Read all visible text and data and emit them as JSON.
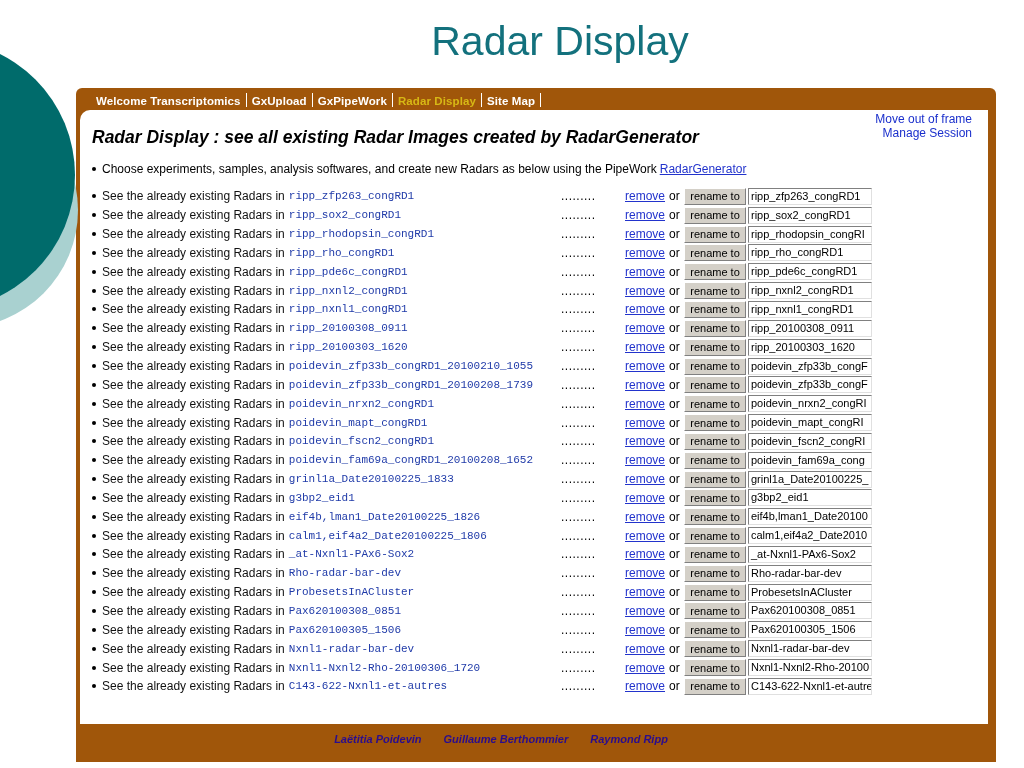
{
  "slide_title": "Radar Display",
  "nav": [
    {
      "label": "Welcome Transcriptomics",
      "selected": false
    },
    {
      "label": "GxUpload",
      "selected": false
    },
    {
      "label": "GxPipeWork",
      "selected": false
    },
    {
      "label": "Radar Display",
      "selected": true
    },
    {
      "label": "Site Map",
      "selected": false
    }
  ],
  "frame_links": [
    "Move out of frame",
    "Manage Session"
  ],
  "heading": "Radar Display : see all existing Radar Images created by RadarGenerator",
  "intro": {
    "text": "Choose experiments, samples, analysis softwares, and create new Radars as below using the PipeWork",
    "link": "RadarGenerator"
  },
  "rows": [
    {
      "prefix": "See the already existing Radars in",
      "name": "ripp_zfp263_congRD1",
      "dots": ".........",
      "remove": "remove",
      "or": "or",
      "button": "rename to",
      "value": "ripp_zfp263_congRD1"
    },
    {
      "prefix": "See the already existing Radars in",
      "name": "ripp_sox2_congRD1",
      "dots": ".........",
      "remove": "remove",
      "or": "or",
      "button": "rename to",
      "value": "ripp_sox2_congRD1"
    },
    {
      "prefix": "See the already existing Radars in",
      "name": "ripp_rhodopsin_congRD1",
      "dots": ".........",
      "remove": "remove",
      "or": "or",
      "button": "rename to",
      "value": "ripp_rhodopsin_congRI"
    },
    {
      "prefix": "See the already existing Radars in",
      "name": "ripp_rho_congRD1",
      "dots": ".........",
      "remove": "remove",
      "or": "or",
      "button": "rename to",
      "value": "ripp_rho_congRD1"
    },
    {
      "prefix": "See the already existing Radars in",
      "name": "ripp_pde6c_congRD1",
      "dots": ".........",
      "remove": "remove",
      "or": "or",
      "button": "rename to",
      "value": "ripp_pde6c_congRD1"
    },
    {
      "prefix": "See the already existing Radars in",
      "name": "ripp_nxnl2_congRD1",
      "dots": ".........",
      "remove": "remove",
      "or": "or",
      "button": "rename to",
      "value": "ripp_nxnl2_congRD1"
    },
    {
      "prefix": "See the already existing Radars in",
      "name": "ripp_nxnl1_congRD1",
      "dots": ".........",
      "remove": "remove",
      "or": "or",
      "button": "rename to",
      "value": "ripp_nxnl1_congRD1"
    },
    {
      "prefix": "See the already existing Radars in",
      "name": "ripp_20100308_0911",
      "dots": ".........",
      "remove": "remove",
      "or": "or",
      "button": "rename to",
      "value": "ripp_20100308_0911"
    },
    {
      "prefix": "See the already existing Radars in",
      "name": "ripp_20100303_1620",
      "dots": ".........",
      "remove": "remove",
      "or": "or",
      "button": "rename to",
      "value": "ripp_20100303_1620"
    },
    {
      "prefix": "See the already existing Radars in",
      "name": "poidevin_zfp33b_congRD1_20100210_1055",
      "dots": ".........",
      "remove": "remove",
      "or": "or",
      "button": "rename to",
      "value": "poidevin_zfp33b_congF"
    },
    {
      "prefix": "See the already existing Radars in",
      "name": "poidevin_zfp33b_congRD1_20100208_1739",
      "dots": ".........",
      "remove": "remove",
      "or": "or",
      "button": "rename to",
      "value": "poidevin_zfp33b_congF"
    },
    {
      "prefix": "See the already existing Radars in",
      "name": "poidevin_nrxn2_congRD1",
      "dots": ".........",
      "remove": "remove",
      "or": "or",
      "button": "rename to",
      "value": "poidevin_nrxn2_congRI"
    },
    {
      "prefix": "See the already existing Radars in",
      "name": "poidevin_mapt_congRD1",
      "dots": ".........",
      "remove": "remove",
      "or": "or",
      "button": "rename to",
      "value": "poidevin_mapt_congRI"
    },
    {
      "prefix": "See the already existing Radars in",
      "name": "poidevin_fscn2_congRD1",
      "dots": ".........",
      "remove": "remove",
      "or": "or",
      "button": "rename to",
      "value": "poidevin_fscn2_congRI"
    },
    {
      "prefix": "See the already existing Radars in",
      "name": "poidevin_fam69a_congRD1_20100208_1652",
      "dots": ".........",
      "remove": "remove",
      "or": "or",
      "button": "rename to",
      "value": "poidevin_fam69a_cong"
    },
    {
      "prefix": "See the already existing Radars in",
      "name": "grinl1a_Date20100225_1833",
      "dots": ".........",
      "remove": "remove",
      "or": "or",
      "button": "rename to",
      "value": "grinl1a_Date20100225_"
    },
    {
      "prefix": "See the already existing Radars in",
      "name": "g3bp2_eid1",
      "dots": ".........",
      "remove": "remove",
      "or": "or",
      "button": "rename to",
      "value": "g3bp2_eid1"
    },
    {
      "prefix": "See the already existing Radars in",
      "name": "eif4b,lman1_Date20100225_1826",
      "dots": ".........",
      "remove": "remove",
      "or": "or",
      "button": "rename to",
      "value": "eif4b,lman1_Date20100"
    },
    {
      "prefix": "See the already existing Radars in",
      "name": "calm1,eif4a2_Date20100225_1806",
      "dots": ".........",
      "remove": "remove",
      "or": "or",
      "button": "rename to",
      "value": "calm1,eif4a2_Date2010"
    },
    {
      "prefix": "See the already existing Radars in",
      "name": "_at-Nxnl1-PAx6-Sox2",
      "dots": ".........",
      "remove": "remove",
      "or": "or",
      "button": "rename to",
      "value": "_at-Nxnl1-PAx6-Sox2"
    },
    {
      "prefix": "See the already existing Radars in",
      "name": "Rho-radar-bar-dev",
      "dots": ".........",
      "remove": "remove",
      "or": "or",
      "button": "rename to",
      "value": "Rho-radar-bar-dev"
    },
    {
      "prefix": "See the already existing Radars in",
      "name": "ProbesetsInACluster",
      "dots": ".........",
      "remove": "remove",
      "or": "or",
      "button": "rename to",
      "value": "ProbesetsInACluster"
    },
    {
      "prefix": "See the already existing Radars in",
      "name": "Pax620100308_0851",
      "dots": ".........",
      "remove": "remove",
      "or": "or",
      "button": "rename to",
      "value": "Pax620100308_0851"
    },
    {
      "prefix": "See the already existing Radars in",
      "name": "Pax620100305_1506",
      "dots": ".........",
      "remove": "remove",
      "or": "or",
      "button": "rename to",
      "value": "Pax620100305_1506"
    },
    {
      "prefix": "See the already existing Radars in",
      "name": "Nxnl1-radar-bar-dev",
      "dots": ".........",
      "remove": "remove",
      "or": "or",
      "button": "rename to",
      "value": "Nxnl1-radar-bar-dev"
    },
    {
      "prefix": "See the already existing Radars in",
      "name": "Nxnl1-Nxnl2-Rho-20100306_1720",
      "dots": ".........",
      "remove": "remove",
      "or": "or",
      "button": "rename to",
      "value": "Nxnl1-Nxnl2-Rho-20100"
    },
    {
      "prefix": "See the already existing Radars in",
      "name": "C143-622-Nxnl1-et-autres",
      "dots": ".........",
      "remove": "remove",
      "or": "or",
      "button": "rename to",
      "value": "C143-622-Nxnl1-et-autre"
    }
  ],
  "authors": [
    "Laëtitia Poidevin",
    "Guillaume Berthommier",
    "Raymond Ripp"
  ]
}
